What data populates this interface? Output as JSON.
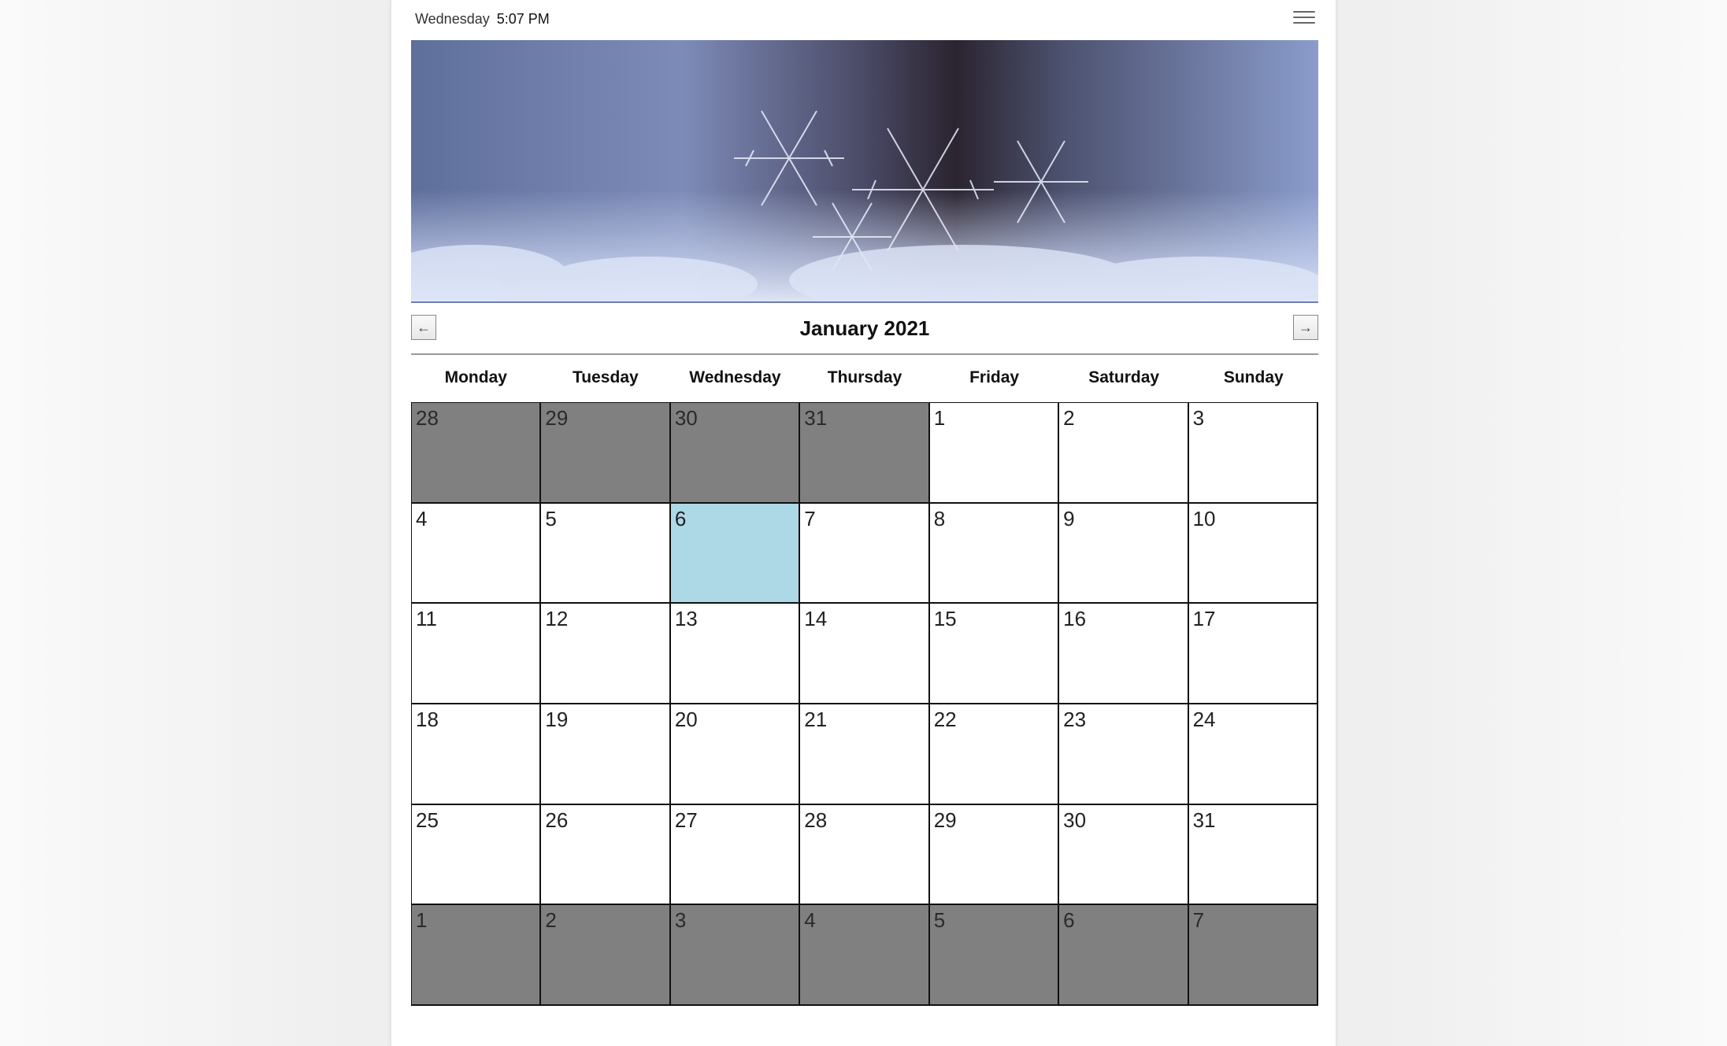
{
  "header": {
    "day": "Wednesday",
    "time": "5:07 PM",
    "menu_icon": "hamburger-menu-icon"
  },
  "calendar": {
    "title": "January 2021",
    "prev_icon": "arrow-left-icon",
    "next_icon": "arrow-right-icon",
    "prev_glyph": "←",
    "next_glyph": "→",
    "weekdays": [
      "Monday",
      "Tuesday",
      "Wednesday",
      "Thursday",
      "Friday",
      "Saturday",
      "Sunday"
    ],
    "colors": {
      "other_month": "#808080",
      "today": "#add8e6",
      "current": "#ffffff"
    },
    "weeks": [
      [
        {
          "d": "28",
          "s": "other"
        },
        {
          "d": "29",
          "s": "other"
        },
        {
          "d": "30",
          "s": "other"
        },
        {
          "d": "31",
          "s": "other"
        },
        {
          "d": "1",
          "s": "current"
        },
        {
          "d": "2",
          "s": "current"
        },
        {
          "d": "3",
          "s": "current"
        }
      ],
      [
        {
          "d": "4",
          "s": "current"
        },
        {
          "d": "5",
          "s": "current"
        },
        {
          "d": "6",
          "s": "today"
        },
        {
          "d": "7",
          "s": "current"
        },
        {
          "d": "8",
          "s": "current"
        },
        {
          "d": "9",
          "s": "current"
        },
        {
          "d": "10",
          "s": "current"
        }
      ],
      [
        {
          "d": "11",
          "s": "current"
        },
        {
          "d": "12",
          "s": "current"
        },
        {
          "d": "13",
          "s": "current"
        },
        {
          "d": "14",
          "s": "current"
        },
        {
          "d": "15",
          "s": "current"
        },
        {
          "d": "16",
          "s": "current"
        },
        {
          "d": "17",
          "s": "current"
        }
      ],
      [
        {
          "d": "18",
          "s": "current"
        },
        {
          "d": "19",
          "s": "current"
        },
        {
          "d": "20",
          "s": "current"
        },
        {
          "d": "21",
          "s": "current"
        },
        {
          "d": "22",
          "s": "current"
        },
        {
          "d": "23",
          "s": "current"
        },
        {
          "d": "24",
          "s": "current"
        }
      ],
      [
        {
          "d": "25",
          "s": "current"
        },
        {
          "d": "26",
          "s": "current"
        },
        {
          "d": "27",
          "s": "current"
        },
        {
          "d": "28",
          "s": "current"
        },
        {
          "d": "29",
          "s": "current"
        },
        {
          "d": "30",
          "s": "current"
        },
        {
          "d": "31",
          "s": "current"
        }
      ],
      [
        {
          "d": "1",
          "s": "other"
        },
        {
          "d": "2",
          "s": "other"
        },
        {
          "d": "3",
          "s": "other"
        },
        {
          "d": "4",
          "s": "other"
        },
        {
          "d": "5",
          "s": "other"
        },
        {
          "d": "6",
          "s": "other"
        },
        {
          "d": "7",
          "s": "other"
        }
      ]
    ]
  }
}
